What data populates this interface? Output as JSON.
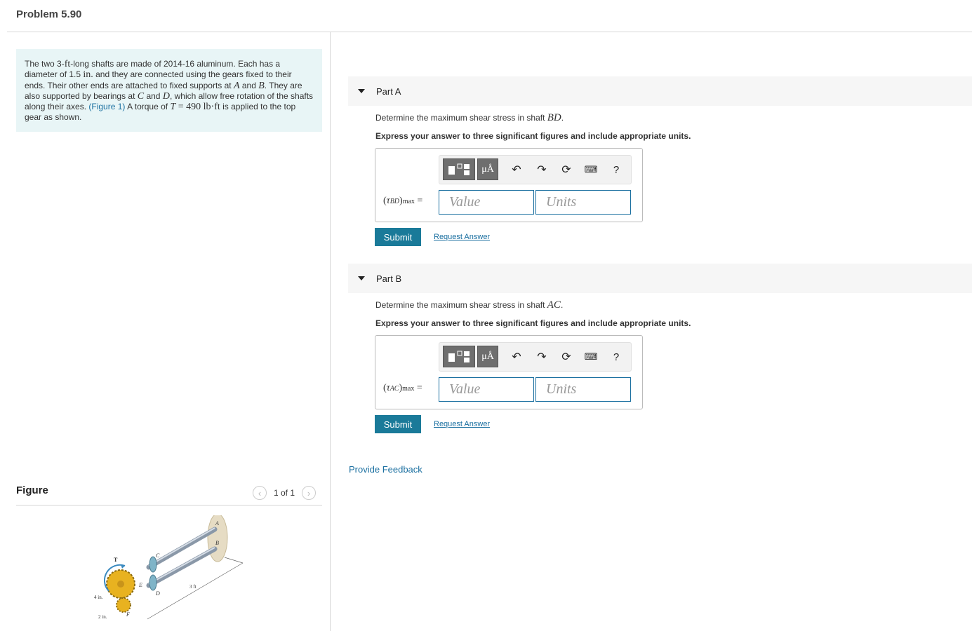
{
  "page": {
    "title": "Problem 5.90"
  },
  "problem": {
    "t1": "The two 3-",
    "m_ft": "ft",
    "t2": "-long shafts are made of 2014-16 aluminum. Each has a diameter of 1.5 ",
    "m_in": "in.",
    "t3": " and they are connected using the gears fixed to their ends. Their other ends are attached to fixed supports at ",
    "A": "A",
    "t4": " and ",
    "B": "B",
    "t5": ". They are also supported by bearings at ",
    "C": "C",
    "t6": " and ",
    "D": "D",
    "t7": ", which allow free rotation of the shafts along their axes. ",
    "figure_link": "(Figure 1)",
    "t8": " A torque of ",
    "T_sym": "T",
    "T_eq": " = 490 lb·ft",
    "t9": " is applied to the top gear as shown."
  },
  "figure": {
    "label": "Figure",
    "count": "1 of 1",
    "prev_icon": "chevron-left-icon",
    "next_icon": "chevron-right-icon",
    "labels": {
      "A": "A",
      "B": "B",
      "C": "C",
      "D": "D",
      "E": "E",
      "F": "F",
      "T": "T",
      "len": "3 ft",
      "r1": "4 in.",
      "r2": "2 in."
    }
  },
  "parts": [
    {
      "header": "Part A",
      "q_prefix": "Determine the maximum shear stress in shaft ",
      "q_sym": "BD",
      "q_suffix": ".",
      "instruction": "Express your answer to three significant figures and include appropriate units.",
      "eq_open": "(",
      "eq_tau": "τ",
      "eq_sub": "BD",
      "eq_close": ")",
      "eq_max": "max",
      "eq_sign": " =",
      "value_placeholder": "Value",
      "units_placeholder": "Units",
      "units_btn": "μÅ",
      "help": "?",
      "submit": "Submit",
      "request": "Request Answer"
    },
    {
      "header": "Part B",
      "q_prefix": "Determine the maximum shear stress in shaft ",
      "q_sym": "AC",
      "q_suffix": ".",
      "instruction": "Express your answer to three significant figures and include appropriate units.",
      "eq_open": "(",
      "eq_tau": "τ",
      "eq_sub": "AC",
      "eq_close": ")",
      "eq_max": "max",
      "eq_sign": " =",
      "value_placeholder": "Value",
      "units_placeholder": "Units",
      "units_btn": "μÅ",
      "help": "?",
      "submit": "Submit",
      "request": "Request Answer"
    }
  ],
  "feedback": "Provide Feedback",
  "colors": {
    "accent": "#1a7a99",
    "link": "#1a6fa0",
    "problem_bg": "#e8f5f6"
  }
}
